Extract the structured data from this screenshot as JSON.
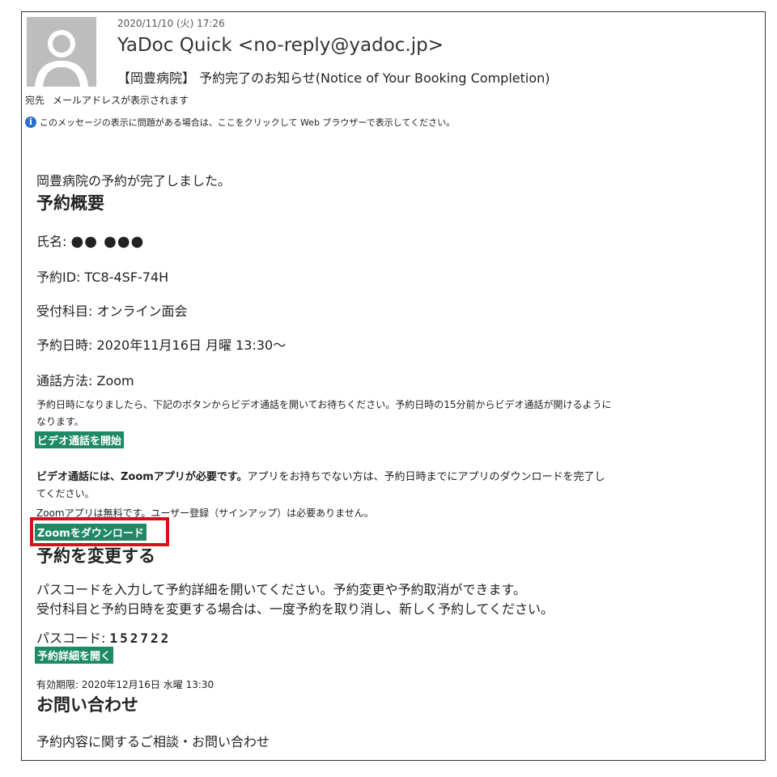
{
  "header": {
    "date": "2020/11/10 (火) 17:26",
    "from": "YaDoc Quick <no-reply@yadoc.jp>",
    "subject": "【岡豊病院】 予約完了のお知らせ(Notice of Your Booking Completion)",
    "to_label": "宛先",
    "to_value": "メールアドレスが表示されます",
    "info_notice": "このメッセージの表示に問題がある場合は、ここをクリックして Web ブラウザーで表示してください。"
  },
  "body": {
    "intro": "岡豊病院の予約が完了しました。",
    "summary_heading": "予約概要",
    "name_label": "氏名:",
    "name_value": "●● ●●●",
    "booking_id": "予約ID: TC8-4SF-74H",
    "department": "受付科目: オンライン面会",
    "datetime": "予約日時: 2020年11月16日 月曜 13:30～",
    "call_method": "通話方法: Zoom",
    "call_instruction_1": "予約日時になりましたら、下記のボタンからビデオ通話を開いてお待ちください。予約日時の15分前からビデオ通話が開けるように",
    "call_instruction_2": "なります。",
    "start_call_button": "ビデオ通話を開始",
    "zoom_required_bold": "ビデオ通話には、Zoomアプリが必要です。",
    "zoom_required_rest": "アプリをお持ちでない方は、予約日時までにアプリのダウンロードを完了し",
    "zoom_required_2": "てください。",
    "zoom_free": "Zoomアプリは無料です。ユーザー登録（サインアップ）は必要ありません。",
    "download_button": "Zoomをダウンロード",
    "change_heading": "予約を変更する",
    "change_text_1": "パスコードを入力して予約詳細を開いてください。予約変更や予約取消ができます。",
    "change_text_2": "受付科目と予約日時を変更する場合は、一度予約を取り消し、新しく予約してください。",
    "passcode_label": "パスコード:",
    "passcode_value": "152722",
    "open_details_button": "予約詳細を開く",
    "expiry": "有効期限: 2020年12月16日 水曜 13:30",
    "contact_heading": "お問い合わせ",
    "contact_text": "予約内容に関するご相談・お問い合わせ"
  },
  "colors": {
    "button_green": "#1d8a63",
    "highlight_red": "#d4121a",
    "info_blue": "#2a6fc9"
  },
  "icons": {
    "avatar": "person-silhouette-icon",
    "info": "info-icon"
  }
}
